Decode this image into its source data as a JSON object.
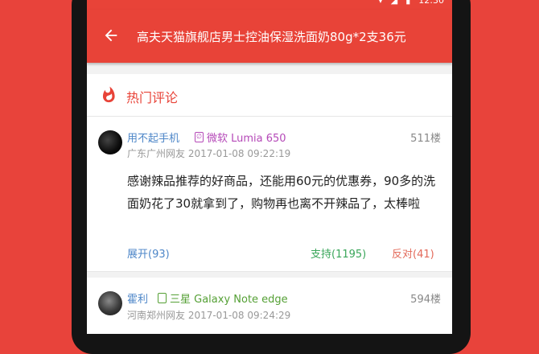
{
  "statusbar": {
    "time": "12:30",
    "icons": [
      "wifi-icon",
      "signal-icon",
      "battery-icon"
    ]
  },
  "appbar": {
    "title": "高夫天猫旗舰店男士控油保湿洗面奶80g*2支36元"
  },
  "section": {
    "title": "热门评论"
  },
  "comments": [
    {
      "user": "用不起手机",
      "device": "微软 Lumia 650",
      "floor": "511楼",
      "meta": "广东广州网友 2017-01-08 09:22:19",
      "content": "感谢辣品推荐的好商品，还能用60元的优惠券，90多的洗面奶花了30就拿到了，购物再也离不开辣品了，太棒啦",
      "expand": "展开(93)",
      "support": "支持(1195)",
      "oppose": "反对(41)"
    },
    {
      "user": "霍利",
      "device": "三星 Galaxy Note edge",
      "floor": "594楼",
      "meta": "河南郑州网友 2017-01-08 09:24:29"
    }
  ],
  "colors": {
    "brand": "#e84338",
    "link": "#4d86c8",
    "support": "#3aa65a",
    "oppose": "#e36a5a"
  }
}
